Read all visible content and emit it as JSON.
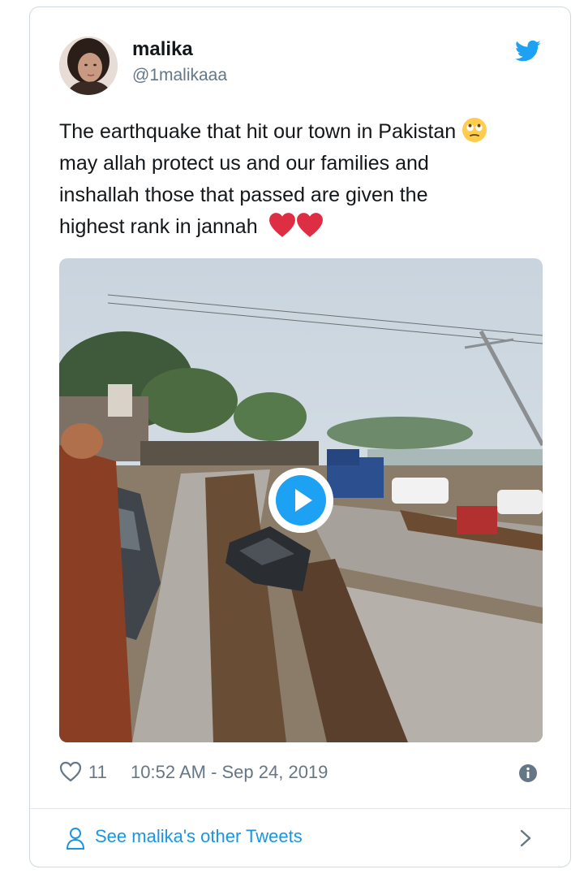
{
  "author": {
    "name": "malika",
    "handle": "@1malikaaa"
  },
  "tweet": {
    "text_line1": "The earthquake that hit our town in Pakistan",
    "text_line2": "may allah protect us and our families and",
    "text_line3": "inshallah those that passed are given the",
    "text_line4": "highest rank in jannah"
  },
  "meta": {
    "like_count": "11",
    "timestamp": "10:52 AM - Sep 24, 2019"
  },
  "footer": {
    "label": "See malika's other Tweets"
  },
  "colors": {
    "twitter_blue": "#1da1f2",
    "link_blue": "#1b95e0",
    "heart_red": "#e0245e"
  },
  "icons": [
    "twitter-bird-icon",
    "rolling-eyes-emoji",
    "red-heart-emoji",
    "play-icon",
    "heart-outline-icon",
    "info-icon",
    "person-icon",
    "chevron-right-icon"
  ]
}
